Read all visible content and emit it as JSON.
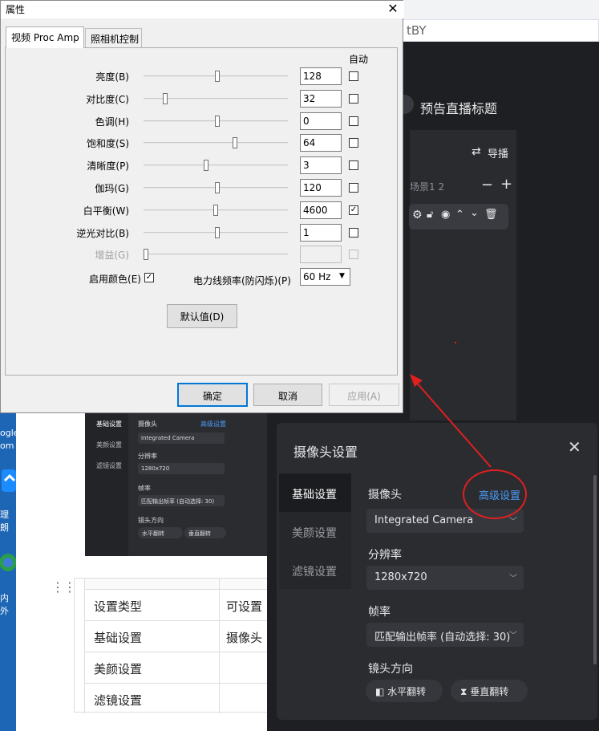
{
  "browser": {
    "tab_title_fragment": "tBY"
  },
  "taskbar_left": {
    "labels": [
      "ogle",
      "om",
      "理朗",
      "内外"
    ]
  },
  "mini_screenshot": {
    "sidebar": [
      "基础设置",
      "美颜设置",
      "滤镜设置"
    ],
    "camera_label": "摄像头",
    "advanced_link": "高级设置",
    "camera_value": "Integrated Camera",
    "resolution_label": "分辨率",
    "resolution_value": "1280x720",
    "framerate_label": "帧率",
    "framerate_value": "匹配输出帧率 (自动选择: 30)",
    "orientation_label": "镜头方向",
    "flip_h": "水平翻转",
    "flip_v": "垂直翻转"
  },
  "doc_table": {
    "headers": [
      "设置类型",
      "可设置"
    ],
    "rows": [
      [
        "基础设置",
        "摄像头"
      ],
      [
        "美颜设置",
        ""
      ],
      [
        "滤镜设置",
        ""
      ]
    ]
  },
  "dark_app": {
    "preview_title": "预告直播标题",
    "guide_label": "导播",
    "scene_label": "场景1 2",
    "minus": "−",
    "plus": "+"
  },
  "camera_dialog": {
    "title": "摄像头设置",
    "tabs": [
      "基础设置",
      "美颜设置",
      "滤镜设置"
    ],
    "active_tab": 0,
    "camera_label": "摄像头",
    "advanced_link": "高级设置",
    "camera_value": "Integrated Camera",
    "resolution_label": "分辨率",
    "resolution_value": "1280x720",
    "framerate_label": "帧率",
    "framerate_value": "匹配输出帧率 (自动选择: 30)",
    "orientation_label": "镜头方向",
    "flip_h": "水平翻转",
    "flip_v": "垂直翻转",
    "colors": {
      "bg": "#2b2c30",
      "link": "#4a9af5",
      "annotation": "#e01f1f"
    }
  },
  "props_dialog": {
    "title": "属性",
    "tabs": [
      "视频 Proc Amp",
      "照相机控制"
    ],
    "auto_header": "自动",
    "rows": [
      {
        "label": "亮度(B)",
        "value": "128",
        "fraction": 0.51,
        "auto": false,
        "disabled": false
      },
      {
        "label": "对比度(C)",
        "value": "32",
        "fraction": 0.14,
        "auto": false,
        "disabled": false
      },
      {
        "label": "色调(H)",
        "value": "0",
        "fraction": 0.51,
        "auto": false,
        "disabled": false
      },
      {
        "label": "饱和度(S)",
        "value": "64",
        "fraction": 0.64,
        "auto": false,
        "disabled": false
      },
      {
        "label": "清晰度(P)",
        "value": "3",
        "fraction": 0.43,
        "auto": false,
        "disabled": false
      },
      {
        "label": "伽玛(G)",
        "value": "120",
        "fraction": 0.51,
        "auto": false,
        "disabled": false
      },
      {
        "label": "白平衡(W)",
        "value": "4600",
        "fraction": 0.5,
        "auto": true,
        "disabled": false
      },
      {
        "label": "逆光对比(B)",
        "value": "1",
        "fraction": 0.51,
        "auto": false,
        "disabled": false
      },
      {
        "label": "增益(G)",
        "value": "",
        "fraction": 0.0,
        "auto": false,
        "disabled": true
      }
    ],
    "enable_color_label": "启用颜色(E)",
    "enable_color_checked": true,
    "powerline_label": "电力线频率(防闪烁)(P)",
    "powerline_value": "60 Hz",
    "default_button": "默认值(D)",
    "ok_button": "确定",
    "cancel_button": "取消",
    "apply_button": "应用(A)"
  }
}
